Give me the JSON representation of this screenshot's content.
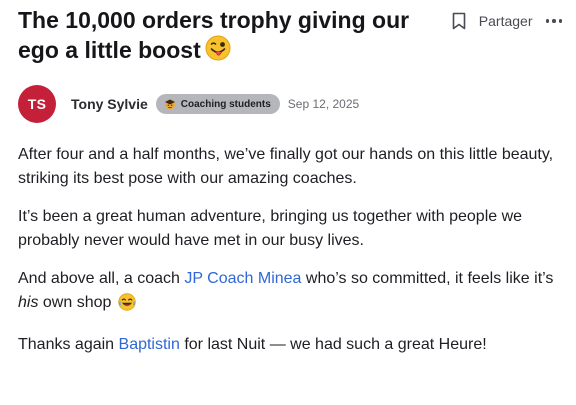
{
  "post": {
    "title": "The 10,000 orders trophy giving our ego a little boost",
    "title_emoji": "face-with-tongue-winking",
    "actions": {
      "share_label": "Partager"
    },
    "author": {
      "initials": "TS",
      "avatar_color": "#c4203a",
      "name": "Tony Sylvie",
      "badge": "Coaching students",
      "date": "Sep 12, 2025"
    },
    "body": {
      "p1": "After four and a half months, we’ve finally got our hands on this little beauty, striking its best pose with our amazing coaches.",
      "p2": "It’s been a great human adventure, bringing us together with people we probably never would have met in our busy lives.",
      "p3_before": "And above all, a coach ",
      "p3_link": "JP Coach Minea",
      "p3_mid": " who’s so committed, it feels like it’s ",
      "p3_em": "his",
      "p3_after": " own shop",
      "p4_before": "Thanks again ",
      "p4_link": "Baptistin",
      "p4_after": " for last Nuit — we had such a great Heure!"
    }
  },
  "colors": {
    "link": "#2f67d6",
    "badge_bg": "#b4b6bb",
    "text": "#1e1e24"
  },
  "icons": [
    "bookmark-icon",
    "more-icon",
    "teacher-icon",
    "laughing-emoji-icon",
    "winking-tongue-emoji-icon"
  ]
}
